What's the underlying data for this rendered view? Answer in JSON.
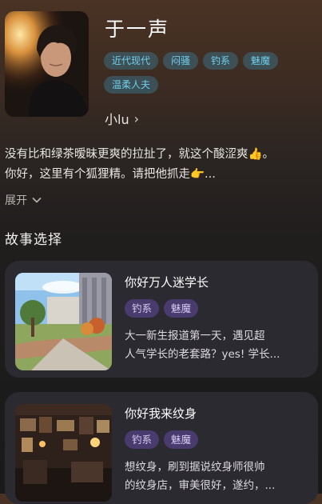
{
  "character": {
    "name": "于一声",
    "tags": [
      "近代现代",
      "闷骚",
      "钓系",
      "魅魔",
      "温柔人夫"
    ],
    "author": "小lu",
    "author_chevron_icon": "chevron-right-icon",
    "intro_lines": [
      "没有比和绿茶暧昧更爽的拉扯了，就这个酸涩爽👍。",
      "你好，这里有个狐狸精。请把他抓走👉..."
    ],
    "expand_label": "展开",
    "expand_icon": "chevron-down-icon"
  },
  "section_title": "故事选择",
  "stories": [
    {
      "title": "你好万人迷学长",
      "tags": [
        "钓系",
        "魅魔"
      ],
      "desc_lines": [
        "大一新生报道第一天，遇见超",
        "人气学长的老套路？yes! 学长..."
      ]
    },
    {
      "title": "你好我来纹身",
      "tags": [
        "钓系",
        "魅魔"
      ],
      "desc_lines": [
        "想纹身，刷到据说纹身师很帅",
        "的纹身店，审美很好，遂约，..."
      ]
    }
  ],
  "colors": {
    "tag_text": "#6fd0ee",
    "story_tag_bg": "#4a3b6e",
    "card_bg": "#2a2a30"
  }
}
